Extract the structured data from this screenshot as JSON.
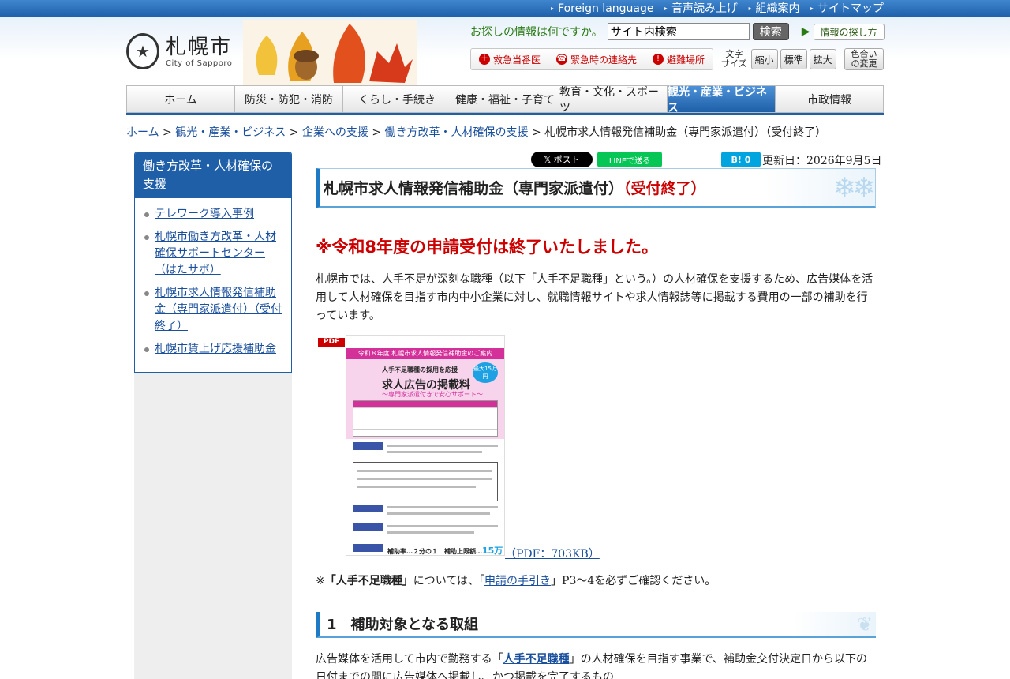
{
  "topbar": {
    "items": [
      "Foreign language",
      "音声読み上げ",
      "組織案内",
      "サイトマップ"
    ]
  },
  "header": {
    "logo_ja": "札幌市",
    "logo_en": "City of Sapporo",
    "search_question": "お探しの情報は何ですか。",
    "search_placeholder": "サイト内検索",
    "search_button": "検索",
    "howto_label": "情報の探し方",
    "emergency": [
      "救急当番医",
      "緊急時の連絡先",
      "避難場所"
    ],
    "fontsize_label_1": "文字",
    "fontsize_label_2": "サイズ",
    "fontsize_buttons": [
      "縮小",
      "標準",
      "拡大"
    ],
    "color_1": "色合い",
    "color_2": "の変更"
  },
  "nav": {
    "items": [
      "ホーム",
      "防災・防犯・消防",
      "くらし・手続き",
      "健康・福祉・子育て",
      "教育・文化・スポーツ",
      "観光・産業・ビジネス",
      "市政情報"
    ],
    "active_index": 5
  },
  "breadcrumb": {
    "links": [
      "ホーム",
      "観光・産業・ビジネス",
      "企業への支援",
      "働き方改革・人材確保の支援"
    ],
    "current": "札幌市求人情報発信補助金（専門家派遣付）（受付終了）"
  },
  "sidebar": {
    "heading": "働き方改革・人材確保の支援",
    "items": [
      "テレワーク導入事例",
      "札幌市働き方改革・人材確保サポートセンター（はたサポ）",
      "札幌市求人情報発信補助金（専門家派遣付）（受付終了）",
      "札幌市賃上げ応援補助金"
    ]
  },
  "social": {
    "x_post": "𝕏 ポスト",
    "line": "LINEで送る",
    "hatena": "B! 0"
  },
  "updated": "更新日：2026年9月5日",
  "page": {
    "title_main": "札幌市求人情報発信補助金（専門家派遣付）",
    "title_closed": "（受付終了）",
    "notice": "※令和8年度の申請受付は終了いたしました。",
    "intro": "札幌市では、人手不足が深刻な職種（以下「人手不足職種」という。）の人材確保を支援するため、広告媒体を活用して人材確保を目指す市内中小企業に対し、就職情報サイトや求人情報誌等に掲載する費用の一部の補助を行っています。",
    "pdf_icon": "PDF",
    "pdf_link": "（PDF：703KB）",
    "note_prefix": "※",
    "note_bold": "「人手不足職種」",
    "note_mid": "については、「",
    "note_link": "申請の手引き",
    "note_suffix": "」P3～4を必ずご確認ください。",
    "section1_title": "1　補助対象となる取組",
    "section1_pre": "広告媒体を活用して市内で勤務する「",
    "section1_link": "人手不足職種",
    "section1_post": "」の人材確保を目指す事業で、補助金交付決定日から以下の日付までの間に広告媒体へ掲載し、かつ掲載を完了するもの"
  },
  "flyer": {
    "banner": "令和８年度 札幌市求人情報発信補助金のご案内",
    "h1": "人手不足職種の採用を応援",
    "h2": "求人広告の掲載料",
    "h3": "～専門家派遣付きで安心サポート～",
    "badge": "最大15万円",
    "amount_prefix": "補助率…２分の１　補助上限額…",
    "amount_value": "15万円"
  },
  "colors": {
    "brand_blue": "#1e5fa8",
    "closed_red": "#cc0000",
    "green_text": "#2a7a14"
  }
}
